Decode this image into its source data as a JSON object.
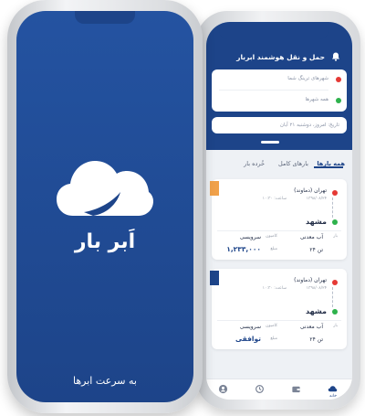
{
  "splash": {
    "logo_icon": "cloud-logo-icon",
    "app_name": "اَبر بار",
    "tagline": "به سرعت ابرها",
    "background": "#1d4489"
  },
  "back_app": {
    "header_title": "حمل و نقل هوشمند ابربار",
    "bell_icon": "bell-icon",
    "filters": {
      "origin_placeholder": "شهرهای ترینگ شما",
      "destination_placeholder": "همه شهرها",
      "date_placeholder": "تاریخ: امروز، دوشنبه ۲۱ آبان"
    },
    "tabs": [
      {
        "label": "همه بارها",
        "active": true
      },
      {
        "label": "بارهای کامل",
        "active": false
      },
      {
        "label": "خُرده بار",
        "active": false
      }
    ],
    "cards": [
      {
        "origin": "تهران (دماوند)",
        "origin_date": "۱۳۹۸/۰۸/۲۴",
        "origin_time": "ساعت: ۱۰:۳۰",
        "destination": "مشهد",
        "cargo_label": "بار",
        "cargo": "آب معدنی",
        "weight": "۲۴ تن",
        "truck_label": "کامیون",
        "truck": "سرویسی",
        "price_label": "مبلغ",
        "price": "۱,۲۳۳,۰۰۰",
        "ribbon_color": "#f0a14a"
      },
      {
        "origin": "تهران (دماوند)",
        "origin_date": "۱۳۹۸/۰۸/۲۴",
        "origin_time": "ساعت: ۱۰:۳۰",
        "destination": "مشهد",
        "cargo_label": "بار",
        "cargo": "آب معدنی",
        "weight": "۲۴ تن",
        "truck_label": "کامیون",
        "truck": "سرویسی",
        "price_label": "مبلغ",
        "price": "توافقی",
        "ribbon_color": "#1d4489"
      }
    ],
    "nav": [
      {
        "icon": "home-cloud-icon",
        "label": "خانه"
      },
      {
        "icon": "wallet-icon",
        "label": ""
      },
      {
        "icon": "history-icon",
        "label": ""
      },
      {
        "icon": "profile-icon",
        "label": ""
      }
    ],
    "colors": {
      "accent": "#1d4489",
      "origin_dot": "#e53935",
      "dest_dot": "#2eb24c"
    }
  }
}
